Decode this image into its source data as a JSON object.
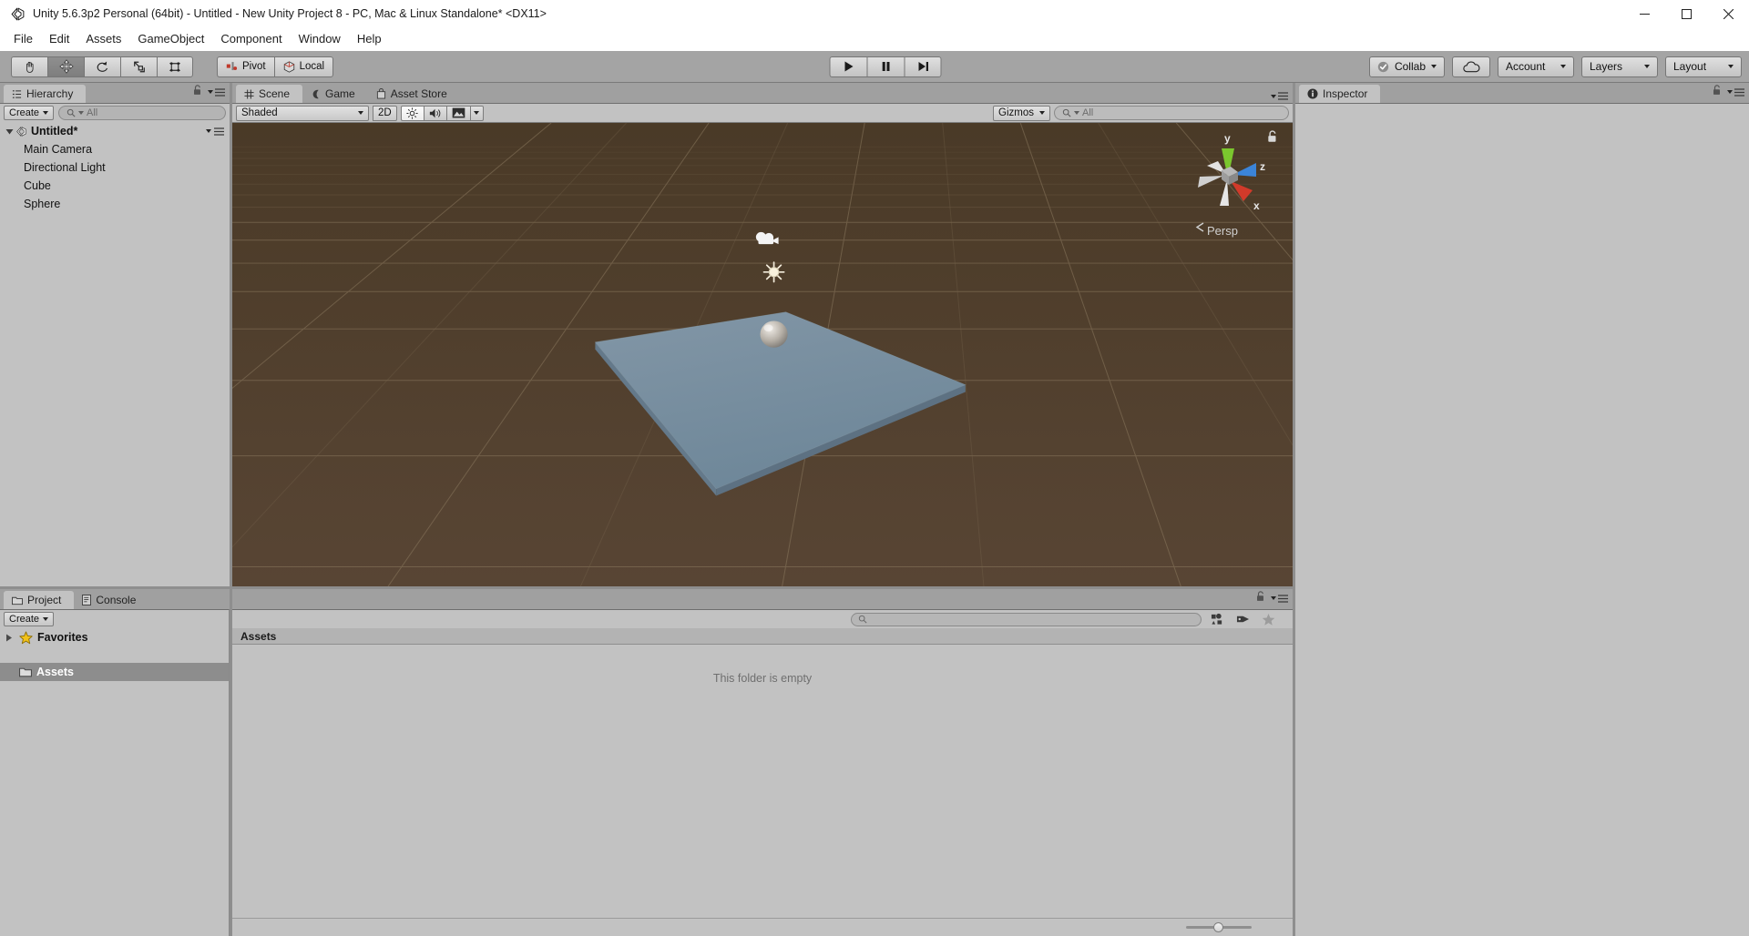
{
  "window": {
    "title": "Unity 5.6.3p2 Personal (64bit) - Untitled - New Unity Project 8 - PC, Mac & Linux Standalone* <DX11>",
    "app_icon": "unity-logo-icon",
    "controls": {
      "minimize": "minimize-icon",
      "maximize": "maximize-icon",
      "close": "close-icon"
    }
  },
  "menu": {
    "items": [
      {
        "label": "File"
      },
      {
        "label": "Edit"
      },
      {
        "label": "Assets"
      },
      {
        "label": "GameObject"
      },
      {
        "label": "Component"
      },
      {
        "label": "Window"
      },
      {
        "label": "Help"
      }
    ]
  },
  "toolbar": {
    "transform_tools": [
      {
        "name": "hand-tool",
        "icon": "hand-icon",
        "active": false
      },
      {
        "name": "move-tool",
        "icon": "move-arrows-icon",
        "active": true
      },
      {
        "name": "rotate-tool",
        "icon": "rotate-icon",
        "active": false
      },
      {
        "name": "scale-tool",
        "icon": "scale-icon",
        "active": false
      },
      {
        "name": "rect-tool",
        "icon": "rect-transform-icon",
        "active": false
      }
    ],
    "pivot_label": "Pivot",
    "pivot_icon": "pivot-icon",
    "local_label": "Local",
    "local_icon": "local-axis-icon",
    "play_controls": [
      {
        "name": "play-button",
        "icon": "play-icon"
      },
      {
        "name": "pause-button",
        "icon": "pause-icon"
      },
      {
        "name": "step-button",
        "icon": "step-forward-icon"
      }
    ],
    "collab_label": "Collab",
    "collab_icon": "check-circle-icon",
    "cloud_icon": "cloud-icon",
    "account_label": "Account",
    "layers_label": "Layers",
    "layout_label": "Layout"
  },
  "hierarchy": {
    "tab_label": "Hierarchy",
    "tab_icon": "hierarchy-icon",
    "lock_icon": "lock-open-icon",
    "menu_icon": "panel-menu-icon",
    "create_label": "Create",
    "search_placeholder": "All",
    "search_icon": "search-icon",
    "scene_name": "Untitled*",
    "scene_icon": "unity-scene-icon",
    "objects": [
      {
        "label": "Main Camera"
      },
      {
        "label": "Directional Light"
      },
      {
        "label": "Cube"
      },
      {
        "label": "Sphere"
      }
    ]
  },
  "scene_panel": {
    "tabs": [
      {
        "label": "Scene",
        "icon": "grid-icon",
        "active": true
      },
      {
        "label": "Game",
        "icon": "gamepad-icon",
        "active": false
      },
      {
        "label": "Asset Store",
        "icon": "store-bag-icon",
        "active": false
      }
    ],
    "menu_icon": "panel-menu-icon",
    "draw_mode": "Shaded",
    "mode_2d_label": "2D",
    "lighting_icon": "sun-icon",
    "audio_icon": "speaker-icon",
    "effects_icon": "image-icon",
    "gizmos_label": "Gizmos",
    "search_placeholder": "All",
    "search_icon": "search-icon",
    "viewport": {
      "axis_gizmo": {
        "y_label": "y",
        "z_label": "z",
        "x_label": "x"
      },
      "projection_label": "Persp",
      "lock_icon": "lock-open-icon",
      "objects": [
        {
          "name": "camera-gizmo",
          "label": "Main Camera"
        },
        {
          "name": "light-gizmo",
          "label": "Directional Light"
        },
        {
          "name": "sphere-mesh",
          "label": "Sphere"
        },
        {
          "name": "cube-mesh",
          "label": "Cube"
        }
      ],
      "colors": {
        "ground": "#4a3a28",
        "grid": "#7b6a55",
        "cube": "#7d96a8",
        "sphere": "#b9b3ab"
      }
    }
  },
  "inspector": {
    "tab_label": "Inspector",
    "tab_icon": "info-icon",
    "lock_icon": "lock-open-icon",
    "menu_icon": "panel-menu-icon"
  },
  "project_panel": {
    "tabs": [
      {
        "label": "Project",
        "icon": "folder-icon",
        "active": true
      },
      {
        "label": "Console",
        "icon": "console-icon",
        "active": false
      }
    ],
    "lock_icon": "lock-open-icon",
    "menu_icon": "panel-menu-icon",
    "create_label": "Create",
    "search_placeholder": "",
    "search_icon": "search-icon",
    "filter_icons": [
      {
        "name": "filter-by-type-icon"
      },
      {
        "name": "filter-by-label-icon"
      },
      {
        "name": "favorite-star-icon"
      }
    ],
    "tree": [
      {
        "label": "Favorites",
        "icon": "star-icon",
        "selected": false,
        "expandable": true
      },
      {
        "label": "Assets",
        "icon": "folder-icon",
        "selected": true,
        "expandable": false
      }
    ],
    "breadcrumb": "Assets",
    "empty_message": "This folder is empty",
    "zoom_slider_value": 42
  }
}
